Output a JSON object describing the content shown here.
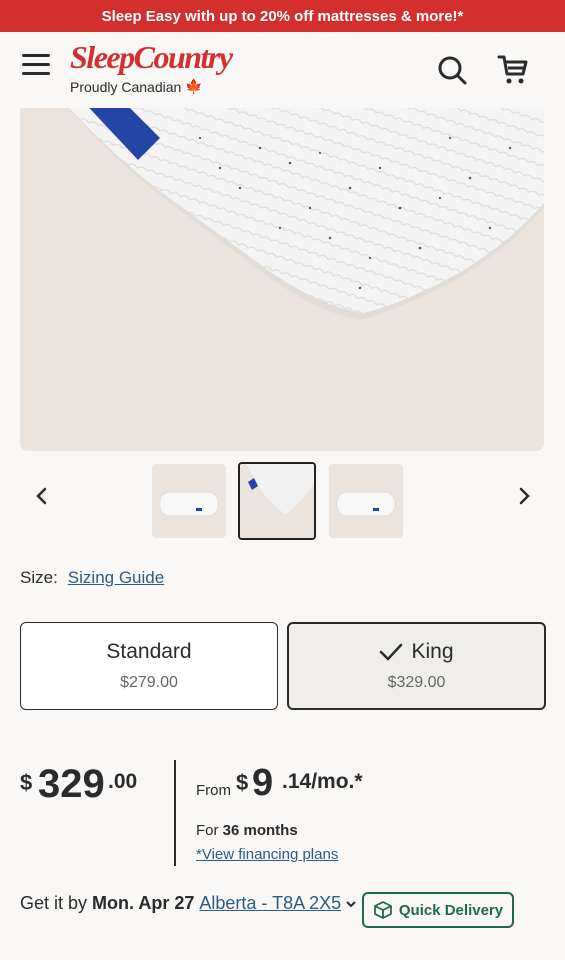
{
  "promo": {
    "text": "Sleep Easy with up to 20% off mattresses & more!*"
  },
  "header": {
    "logo_main": "SleepCountry",
    "logo_sub": "Proudly Canadian"
  },
  "size": {
    "label": "Size:",
    "guide": "Sizing Guide",
    "options": [
      {
        "name": "Standard",
        "price": "$279.00",
        "selected": false
      },
      {
        "name": "King",
        "price": "$329.00",
        "selected": true
      }
    ]
  },
  "price": {
    "currency": "$",
    "integer": "329",
    "cents": ".00"
  },
  "financing": {
    "from": "From",
    "currency": "$",
    "integer": "9",
    "fraction": ".14/mo.*",
    "term_prefix": "For",
    "term": "36 months",
    "plans_link": "*View financing plans"
  },
  "delivery": {
    "prefix": "Get it by",
    "date": "Mon. Apr 27",
    "location": "Alberta - T8A 2X5",
    "quick_label": "Quick Delivery"
  },
  "colors": {
    "brand": "#d32f2f",
    "link": "#2c5c86",
    "quick": "#1f6a50"
  }
}
